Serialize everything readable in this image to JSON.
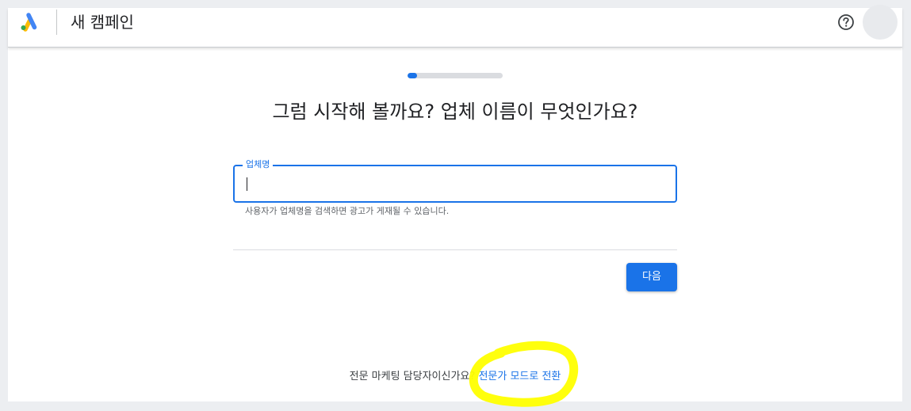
{
  "header": {
    "title": "새 캠페인",
    "help_icon": "help-circle-icon",
    "logo_icon": "google-ads-logo"
  },
  "progress": {
    "fraction": 0.1
  },
  "main": {
    "question": "그럼 시작해 볼까요? 업체 이름이 무엇인가요?",
    "business_name_field": {
      "label": "업체명",
      "value": "",
      "hint": "사용자가 업체명을 검색하면 광고가 게재될 수 있습니다."
    },
    "next_button_label": "다음"
  },
  "footer": {
    "prompt": "전문 마케팅 담당자이신가요?",
    "expert_mode_link": "전문가 모드로 전환"
  },
  "colors": {
    "accent": "#1a73e8",
    "highlight_annotation": "#ffff00"
  }
}
